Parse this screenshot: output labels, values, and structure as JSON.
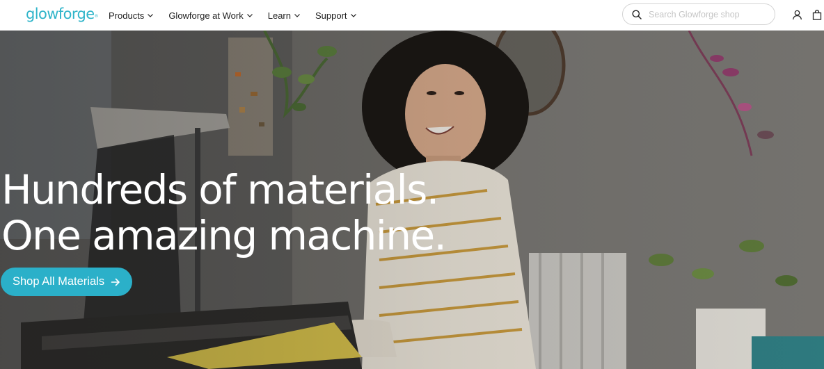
{
  "header": {
    "logo_text": "glowforge",
    "logo_mark": "®",
    "nav": [
      {
        "label": "Products"
      },
      {
        "label": "Glowforge at Work"
      },
      {
        "label": "Learn"
      },
      {
        "label": "Support"
      }
    ],
    "search": {
      "placeholder": "Search Glowforge shop",
      "value": "",
      "icon": "search-icon"
    },
    "account_icon": "user-icon",
    "cart_icon": "shopping-bag-icon"
  },
  "hero": {
    "headline_line1": "Hundreds of materials.",
    "headline_line2": "One amazing machine.",
    "cta_label": "Shop All Materials",
    "cta_icon": "arrow-right-icon",
    "image": "smiling woman loading material into a laser cutter",
    "colors": {
      "accent": "#2bb0c9",
      "logo": "#2eb4c9"
    }
  }
}
